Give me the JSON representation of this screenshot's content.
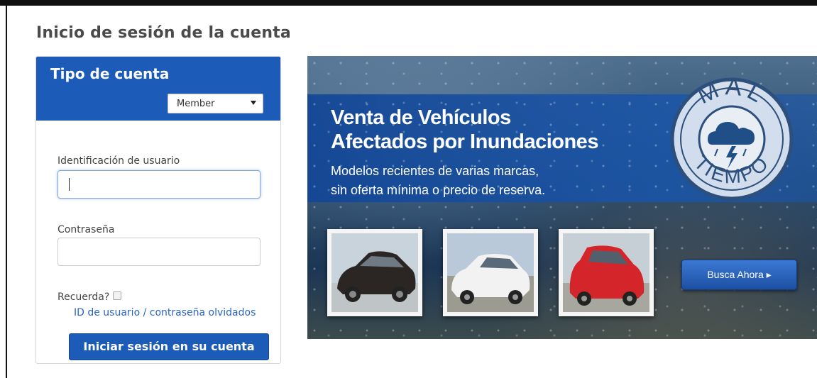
{
  "page": {
    "title": "Inicio de sesión de la cuenta"
  },
  "login": {
    "header_title": "Tipo de cuenta",
    "account_type": {
      "selected": "Member"
    },
    "user_id_label": "Identificación de usuario",
    "user_id_value": "",
    "password_label": "Contraseña",
    "password_value": "",
    "remember_label": "Recuerda?",
    "remember_checked": false,
    "forgot_link": "ID de usuario / contraseña olvidados",
    "submit_label": "Iniciar sesión en su cuenta"
  },
  "banner": {
    "headline_line1": "Venta de Vehículos",
    "headline_line2": "Afectados por Inundaciones",
    "subtitle_line1": "Modelos recientes de varias marcas,",
    "subtitle_line2": "sin oferta mínima o precio de reserva.",
    "stamp_top": "MAL",
    "stamp_bottom": "TIEMPO",
    "cta_label": "Busca Ahora ▸",
    "car_colors": [
      "#2b2623",
      "#f2f2f2",
      "#d4262a"
    ]
  },
  "colors": {
    "brand_blue": "#1d5bb8",
    "link_blue": "#2a66c4"
  }
}
